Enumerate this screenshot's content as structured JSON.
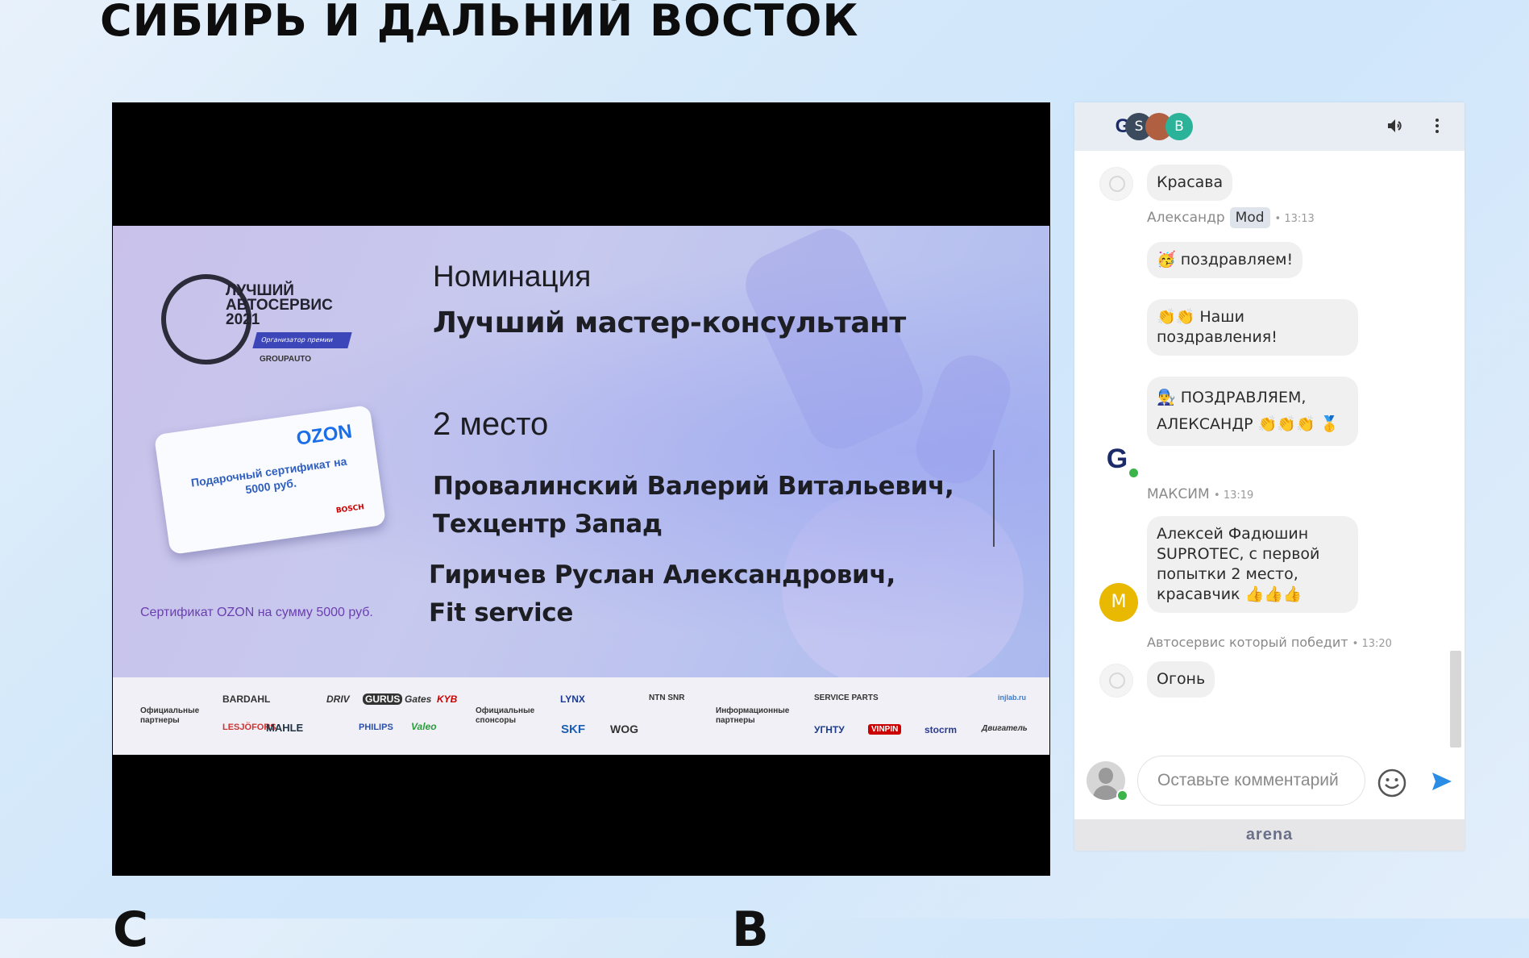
{
  "page": {
    "heading": "СИБИРЬ И ДАЛЬНИЙ ВОСТОК",
    "bottom_cut_left": "С",
    "bottom_cut_right": "В"
  },
  "slide": {
    "logo_lines": [
      "ЛУЧШИЙ",
      "АВТОСЕРВИС",
      "2021"
    ],
    "logo_ribbon": "Организатор премии",
    "logo_brand": "GROUPAUTO",
    "ozon_brand": "OZON",
    "ozon_card_text": "Подарочный сертификат на 5000 руб.",
    "ozon_card_sponsor": "BOSCH",
    "ozon_caption": "Сертификат OZON на сумму 5000 руб.",
    "nomination_label": "Номинация",
    "nomination_title": "Лучший мастер-консультант",
    "place": "2 место",
    "winner_1": "Провалинский Валерий Витальевич, Техцентр Запад",
    "winner_2": "Гиричев Руслан Александрович, Fit service",
    "partners": {
      "official_partners_label": "Официальные партнеры",
      "official_sponsors_label": "Официальные спонсоры",
      "info_partners_label": "Информационные партнеры",
      "logos_row1": [
        "BARDAHL",
        "DRIV",
        "GURUS",
        "Gates",
        "KYB",
        "LYNX",
        "NTN SNR",
        "SERVICE PARTS",
        "injlab.ru"
      ],
      "logos_row2": [
        "LESJÖFORS",
        "MAHLE",
        "PHILIPS",
        "Valeo",
        "SKF",
        "WOG",
        "УГНТУ",
        "VINPIN",
        "stocrm",
        "Двигатель"
      ]
    }
  },
  "chat": {
    "header_avatars": [
      "S",
      "B"
    ],
    "messages": [
      {
        "text": "Красава"
      },
      {
        "author": "Александр",
        "badge": "Mod",
        "time": "• 13:13"
      },
      {
        "text": "🥳 поздравляем!"
      },
      {
        "text": "👏👏 Наши поздравления!"
      },
      {
        "text": "👨‍🔧 ПОЗДРАВЛЯЕМ, АЛЕКСАНДР 👏👏👏 🥇"
      },
      {
        "author": "МАКСИМ",
        "time": "• 13:19",
        "avatar_letter": "M"
      },
      {
        "text": "Алексей Фадюшин SUPROTEC, с первой попытки 2 место, красавчик 👍👍👍"
      },
      {
        "author": "Автосервис который победит",
        "time": "• 13:20"
      },
      {
        "text": "Огонь"
      }
    ],
    "input_placeholder": "Оставьте комментарий",
    "footer_brand": "arena"
  },
  "colors": {
    "mod_badge_bg": "#dfe4ec",
    "avatar_s": "#3b4a5c",
    "avatar_b": "#2bb39a",
    "avatar_m": "#e9b800",
    "send_icon": "#2b8ce6"
  },
  "icons": [
    "groupauto-logo-icon",
    "volume-icon",
    "more-vertical-icon",
    "user-placeholder-icon",
    "emoji-icon",
    "send-icon"
  ]
}
